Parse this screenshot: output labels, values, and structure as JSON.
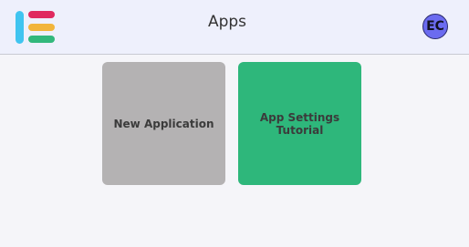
{
  "header": {
    "title": "Apps",
    "avatar_initials": "EC",
    "logo": {
      "icon": "app-logo-icon",
      "colors": {
        "vertical_bar": "#40c4f0",
        "bar_top": "#e0295f",
        "bar_middle": "#f2b53b",
        "bar_bottom": "#32b87c"
      }
    }
  },
  "colors": {
    "header_bg": "#eef0fc",
    "page_bg": "#f5f5f9",
    "avatar_bg": "#6b6bf0"
  },
  "apps": [
    {
      "label": "New Application",
      "color": "#b4b2b3"
    },
    {
      "label": "App Settings Tutorial",
      "color": "#2eb77b"
    }
  ]
}
